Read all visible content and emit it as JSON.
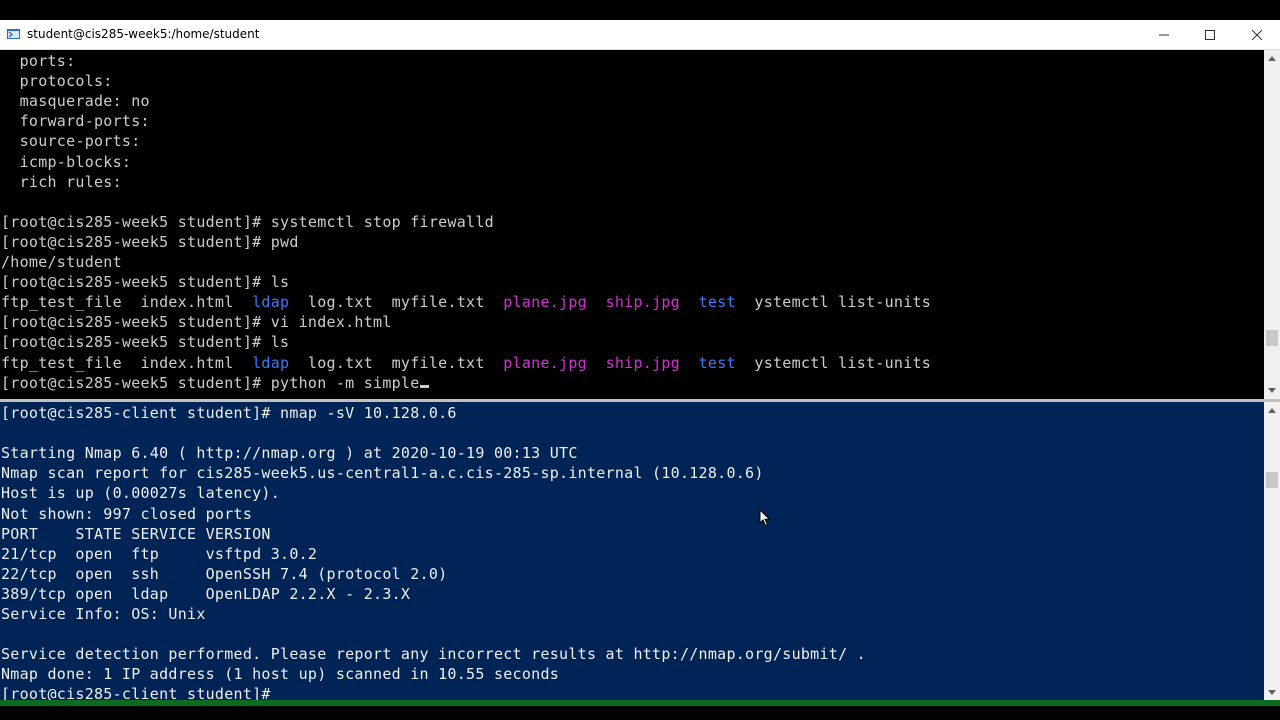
{
  "window": {
    "title": "student@cis285-week5:/home/student",
    "controls": [
      "minimize",
      "maximize",
      "close"
    ]
  },
  "colors": {
    "top_bg": "#000000",
    "bottom_bg": "#012456",
    "directory": "#3b78ff",
    "image_file": "#d32fd3"
  },
  "top_pane": {
    "lines": [
      [
        {
          "t": "  ports:"
        }
      ],
      [
        {
          "t": "  protocols:"
        }
      ],
      [
        {
          "t": "  masquerade: no"
        }
      ],
      [
        {
          "t": "  forward-ports:"
        }
      ],
      [
        {
          "t": "  source-ports:"
        }
      ],
      [
        {
          "t": "  icmp-blocks:"
        }
      ],
      [
        {
          "t": "  rich rules:"
        }
      ],
      [
        {
          "t": ""
        }
      ],
      [
        {
          "t": "[root@cis285-week5 student]# systemctl stop firewalld"
        }
      ],
      [
        {
          "t": "[root@cis285-week5 student]# pwd"
        }
      ],
      [
        {
          "t": "/home/student"
        }
      ],
      [
        {
          "t": "[root@cis285-week5 student]# ls"
        }
      ],
      [
        {
          "t": "ftp_test_file  index.html  "
        },
        {
          "t": "ldap",
          "c": "dir"
        },
        {
          "t": "  log.txt  myfile.txt  "
        },
        {
          "t": "plane.jpg",
          "c": "img"
        },
        {
          "t": "  "
        },
        {
          "t": "ship.jpg",
          "c": "img"
        },
        {
          "t": "  "
        },
        {
          "t": "test",
          "c": "dir"
        },
        {
          "t": "  ystemctl list-units"
        }
      ],
      [
        {
          "t": "[root@cis285-week5 student]# vi index.html"
        }
      ],
      [
        {
          "t": "[root@cis285-week5 student]# ls"
        }
      ],
      [
        {
          "t": "ftp_test_file  index.html  "
        },
        {
          "t": "ldap",
          "c": "dir"
        },
        {
          "t": "  log.txt  myfile.txt  "
        },
        {
          "t": "plane.jpg",
          "c": "img"
        },
        {
          "t": "  "
        },
        {
          "t": "ship.jpg",
          "c": "img"
        },
        {
          "t": "  "
        },
        {
          "t": "test",
          "c": "dir"
        },
        {
          "t": "  ystemctl list-units"
        }
      ],
      [
        {
          "t": "[root@cis285-week5 student]# python -m simple"
        },
        {
          "cursor": true
        }
      ]
    ]
  },
  "bottom_pane": {
    "lines": [
      [
        {
          "t": "[root@cis285-client student]# nmap -sV 10.128.0.6"
        }
      ],
      [
        {
          "t": ""
        }
      ],
      [
        {
          "t": "Starting Nmap 6.40 ( http://nmap.org ) at 2020-10-19 00:13 UTC"
        }
      ],
      [
        {
          "t": "Nmap scan report for cis285-week5.us-central1-a.c.cis-285-sp.internal (10.128.0.6)"
        }
      ],
      [
        {
          "t": "Host is up (0.00027s latency)."
        }
      ],
      [
        {
          "t": "Not shown: 997 closed ports"
        }
      ],
      [
        {
          "t": "PORT    STATE SERVICE VERSION"
        }
      ],
      [
        {
          "t": "21/tcp  open  ftp     vsftpd 3.0.2"
        }
      ],
      [
        {
          "t": "22/tcp  open  ssh     OpenSSH 7.4 (protocol 2.0)"
        }
      ],
      [
        {
          "t": "389/tcp open  ldap    OpenLDAP 2.2.X - 2.3.X"
        }
      ],
      [
        {
          "t": "Service Info: OS: Unix"
        }
      ],
      [
        {
          "t": ""
        }
      ],
      [
        {
          "t": "Service detection performed. Please report any incorrect results at http://nmap.org/submit/ ."
        }
      ],
      [
        {
          "t": "Nmap done: 1 IP address (1 host up) scanned in 10.55 seconds"
        }
      ],
      [
        {
          "t": "[root@cis285-client student]# "
        }
      ]
    ]
  },
  "icons": {
    "app": "terminal-app-icon",
    "minimize": "minimize-icon",
    "maximize": "maximize-icon",
    "close": "close-icon",
    "pointer": "mouse-pointer-icon"
  }
}
